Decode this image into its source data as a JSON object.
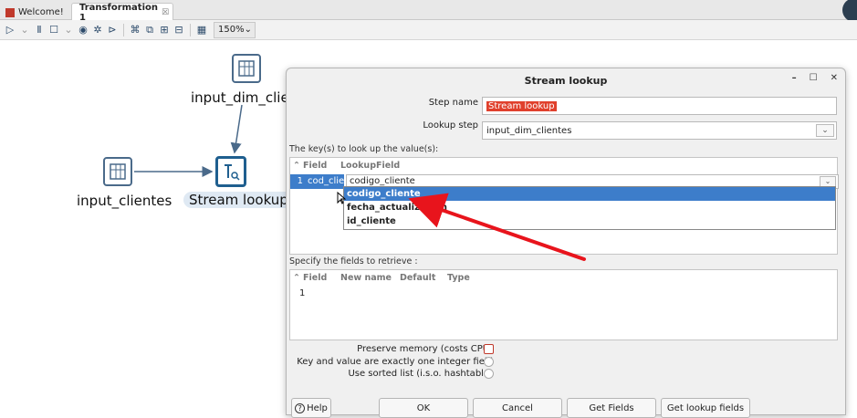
{
  "tabs": [
    {
      "label": "Welcome!",
      "icon": "spoon-icon"
    },
    {
      "label": "Transformation 1",
      "close": "☒",
      "icon": "transformation-icon"
    }
  ],
  "toolbar": {
    "zoom": "150%"
  },
  "canvas": {
    "steps": {
      "input_dim": "input_dim_cliente",
      "input_clientes": "input_clientes",
      "stream_lookup": "Stream lookup"
    }
  },
  "dialog": {
    "title": "Stream lookup",
    "step_name_label": "Step name",
    "step_name_value": "Stream lookup",
    "lookup_step_label": "Lookup step",
    "lookup_step_value": "input_dim_clientes",
    "keys_label": "The key(s) to look up the value(s):",
    "keys_table": {
      "columns": [
        "Field",
        "LookupField"
      ],
      "row_number": "1",
      "field_value": "cod_clie",
      "lookup_value": "codigo_cliente"
    },
    "dropdown_options": [
      "codigo_cliente",
      "fecha_actualizacion",
      "id_cliente"
    ],
    "retrieve_label": "Specify the fields to retrieve :",
    "retrieve_table": {
      "columns": [
        "Field",
        "New name",
        "Default",
        "Type"
      ],
      "row_number": "1"
    },
    "options": {
      "preserve_memory": "Preserve memory (costs CPU)",
      "single_integer": "Key and value are exactly one integer field",
      "sorted_list": "Use sorted list (i.s.o. hashtable)"
    },
    "buttons": {
      "help": "Help",
      "ok": "OK",
      "cancel": "Cancel",
      "get_fields": "Get Fields",
      "get_lookup_fields": "Get lookup fields"
    }
  },
  "colors": {
    "annotation_arrow": "#e8141c",
    "selection": "#3d7dca"
  }
}
